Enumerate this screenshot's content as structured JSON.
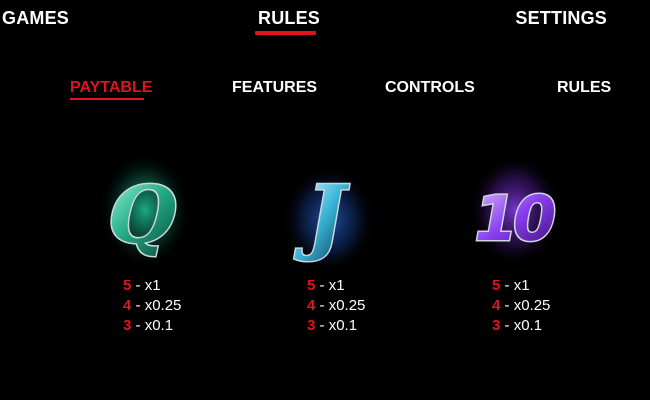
{
  "nav": {
    "games": "GAMES",
    "rules": "RULES",
    "settings": "SETTINGS"
  },
  "subnav": {
    "paytable": "PAYTABLE",
    "features": "FEATURES",
    "controls": "CONTROLS",
    "rules": "RULES"
  },
  "colors": {
    "accent": "#e0141e",
    "background": "#000000",
    "q_glow": "#1fc99a",
    "j_glow": "#2a6bd6",
    "ten_glow": "#8b3ff0"
  },
  "symbols": [
    {
      "icon": "q-symbol-icon",
      "glyph": "Q",
      "payouts": [
        {
          "count": "5",
          "sep": " - ",
          "value": "x1"
        },
        {
          "count": "4",
          "sep": " - ",
          "value": "x0.25"
        },
        {
          "count": "3",
          "sep": " - ",
          "value": "x0.1"
        }
      ]
    },
    {
      "icon": "j-symbol-icon",
      "glyph": "J",
      "payouts": [
        {
          "count": "5",
          "sep": " - ",
          "value": "x1"
        },
        {
          "count": "4",
          "sep": " - ",
          "value": "x0.25"
        },
        {
          "count": "3",
          "sep": " - ",
          "value": "x0.1"
        }
      ]
    },
    {
      "icon": "ten-symbol-icon",
      "glyph": "10",
      "payouts": [
        {
          "count": "5",
          "sep": " - ",
          "value": "x1"
        },
        {
          "count": "4",
          "sep": " - ",
          "value": "x0.25"
        },
        {
          "count": "3",
          "sep": " - ",
          "value": "x0.1"
        }
      ]
    }
  ]
}
